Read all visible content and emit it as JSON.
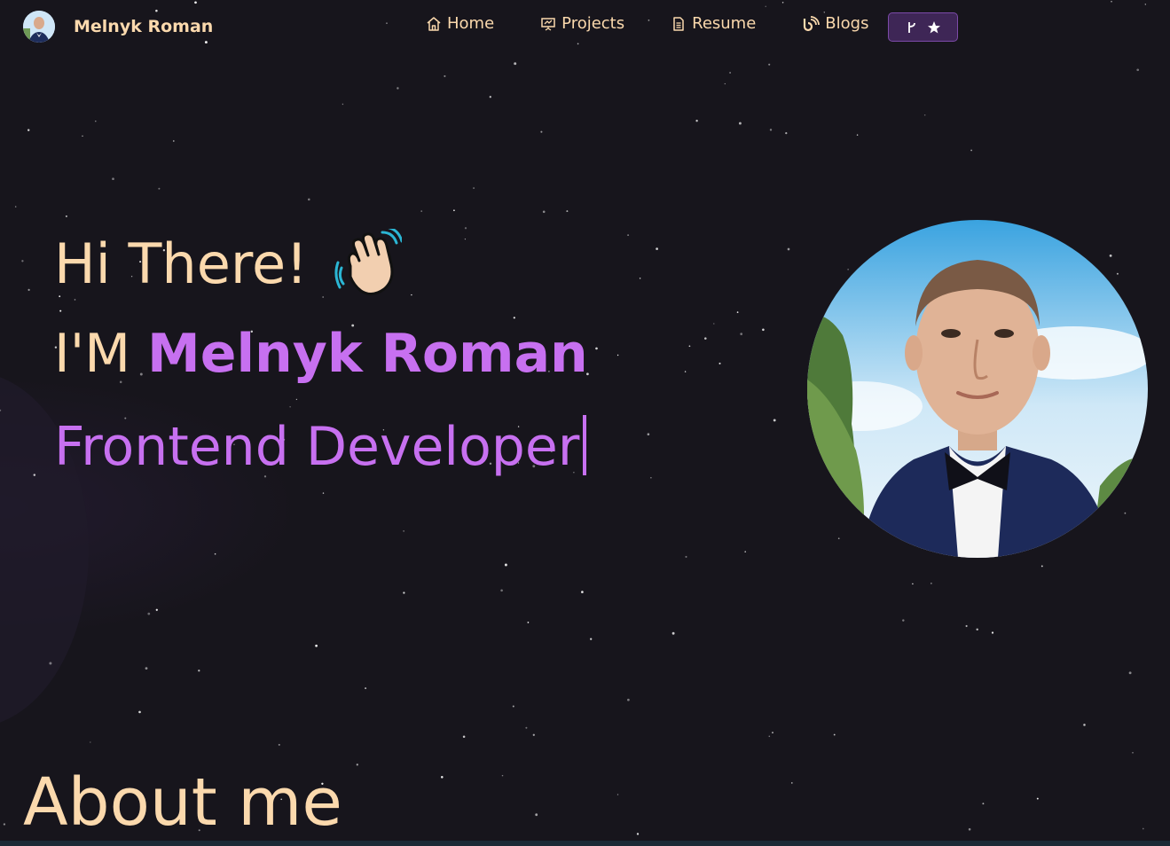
{
  "brand": {
    "name": "Melnyk Roman",
    "avatar_icon": "avatar-photo"
  },
  "nav": {
    "items": [
      {
        "label": "Home",
        "icon": "home-icon"
      },
      {
        "label": "Projects",
        "icon": "presentation-icon"
      },
      {
        "label": "Resume",
        "icon": "document-icon"
      },
      {
        "label": "Blogs",
        "icon": "blog-icon"
      }
    ],
    "github_button": {
      "icons": [
        "git-fork-icon",
        "star-icon"
      ]
    }
  },
  "hero": {
    "greeting": "Hi There!",
    "greeting_emoji": "waving-hand",
    "intro_prefix": "I'M",
    "name": "Melnyk Roman",
    "role": "Frontend Developer"
  },
  "about": {
    "title": "About me"
  },
  "colors": {
    "background": "#17151c",
    "accent_purple": "#c770f0",
    "text_peach": "#fbd9ad",
    "button_bg": "#3e2656"
  }
}
